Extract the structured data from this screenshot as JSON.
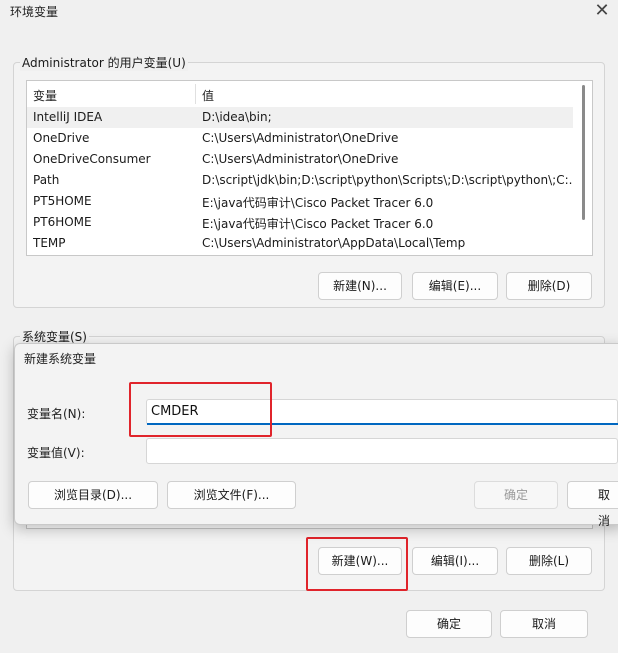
{
  "window": {
    "title": "环境变量",
    "close_glyph": "✕"
  },
  "user_vars": {
    "group_label": "Administrator 的用户变量(U)",
    "columns": {
      "name": "变量",
      "value": "值"
    },
    "rows": [
      {
        "name": "IntelliJ IDEA",
        "value": "D:\\idea\\bin;"
      },
      {
        "name": "OneDrive",
        "value": "C:\\Users\\Administrator\\OneDrive"
      },
      {
        "name": "OneDriveConsumer",
        "value": "C:\\Users\\Administrator\\OneDrive"
      },
      {
        "name": "Path",
        "value": "D:\\script\\jdk\\bin;D:\\script\\python\\Scripts\\;D:\\script\\python\\;C:..."
      },
      {
        "name": "PT5HOME",
        "value": "E:\\java代码审计\\Cisco Packet Tracer 6.0"
      },
      {
        "name": "PT6HOME",
        "value": "E:\\java代码审计\\Cisco Packet Tracer 6.0"
      },
      {
        "name": "TEMP",
        "value": "C:\\Users\\Administrator\\AppData\\Local\\Temp"
      }
    ],
    "buttons": {
      "new": "新建(N)...",
      "edit": "编辑(E)...",
      "delete": "删除(D)"
    }
  },
  "system_vars": {
    "group_label": "系统变量(S)",
    "buttons": {
      "new": "新建(W)...",
      "edit": "编辑(I)...",
      "delete": "删除(L)"
    }
  },
  "footer": {
    "ok": "确定",
    "cancel": "取消"
  },
  "dialog": {
    "title": "新建系统变量",
    "name_label": "变量名(N):",
    "name_value": "CMDER",
    "value_label": "变量值(V):",
    "value_value": "",
    "browse_dir": "浏览目录(D)...",
    "browse_file": "浏览文件(F)...",
    "ok": "确定",
    "cancel": "取消"
  },
  "colors": {
    "highlight": "#e0242b",
    "focus_underline": "#0067c0"
  }
}
